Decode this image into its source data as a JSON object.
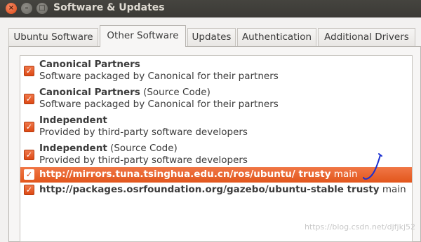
{
  "window": {
    "title": "Software & Updates",
    "buttons": {
      "close": "×",
      "minimize": "–",
      "maximize": "□"
    }
  },
  "tabs": [
    {
      "label": "Ubuntu Software",
      "active": false
    },
    {
      "label": "Other Software",
      "active": true
    },
    {
      "label": "Updates",
      "active": false
    },
    {
      "label": "Authentication",
      "active": false
    },
    {
      "label": "Additional Drivers",
      "active": false
    }
  ],
  "sources": [
    {
      "name": "Canonical Partners",
      "suffix": "",
      "description": "Software packaged by Canonical for their partners",
      "checked": true
    },
    {
      "name": "Canonical Partners",
      "suffix": " (Source Code)",
      "description": "Software packaged by Canonical for their partners",
      "checked": true
    },
    {
      "name": "Independent",
      "suffix": "",
      "description": "Provided by third-party software developers",
      "checked": true
    },
    {
      "name": "Independent",
      "suffix": " (Source Code)",
      "description": "Provided by third-party software developers",
      "checked": true
    },
    {
      "name": "http://mirrors.tuna.tsinghua.edu.cn/ros/ubuntu/ trusty",
      "suffix": " main",
      "checked": true,
      "selected": true
    },
    {
      "name": "http://packages.osrfoundation.org/gazebo/ubuntu-stable trusty",
      "suffix": " main",
      "checked": true,
      "selected": false
    }
  ],
  "watermark": "https://blog.csdn.net/djfjkj52",
  "colors": {
    "accent": "#dd4814",
    "titlebar": "#3b3a36",
    "window_bg": "#f2f1f0",
    "annotation": "#1a2fd0"
  },
  "icons": {
    "checkbox": "check-mark",
    "annotation": "pen-scribble"
  }
}
